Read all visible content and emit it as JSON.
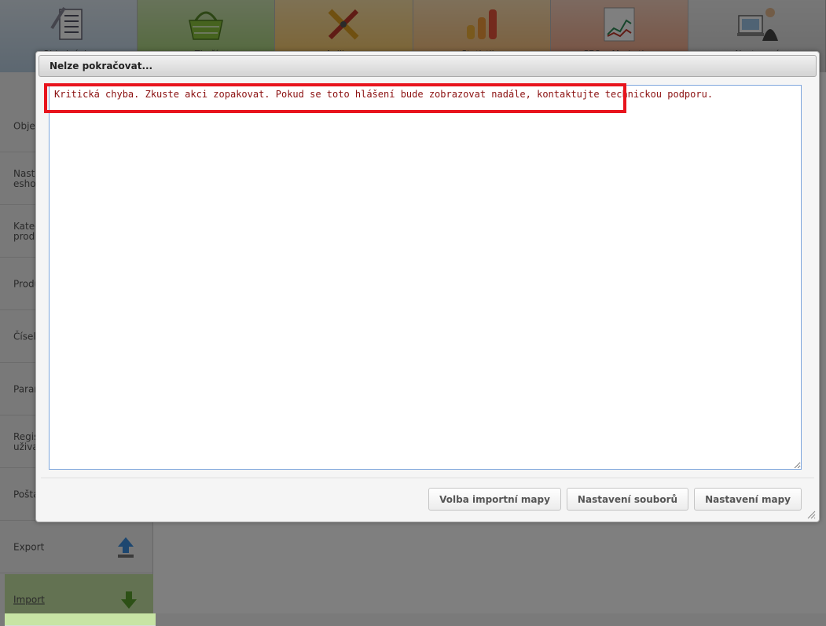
{
  "topnav": {
    "tiles": [
      {
        "label": "Objednávky",
        "icon": "checklist-icon"
      },
      {
        "label": "Zboží",
        "icon": "basket-icon"
      },
      {
        "label": "Aplikace",
        "icon": "tools-icon"
      },
      {
        "label": "Statistiky",
        "icon": "bar-chart-icon"
      },
      {
        "label": "SEO a Marketing",
        "icon": "line-chart-icon"
      },
      {
        "label": "Nastavení",
        "icon": "user-computer-icon"
      }
    ]
  },
  "sidebar": {
    "items": [
      {
        "label": "Objednávky"
      },
      {
        "label": "Nastavení\neshopu"
      },
      {
        "label": "Kategorie\nproduktů"
      },
      {
        "label": "Produkty"
      },
      {
        "label": "Číselníky"
      },
      {
        "label": "Parametry"
      },
      {
        "label": "Registrace\nuživatelů"
      },
      {
        "label": "Pošta"
      },
      {
        "label": "Export",
        "icon": "upload-arrow-icon"
      },
      {
        "label": "Import",
        "icon": "download-arrow-icon",
        "active": true
      }
    ]
  },
  "dialog": {
    "title": "Nelze pokračovat...",
    "message": "Kritická chyba. Zkuste akci zopakovat. Pokud se toto hlášení bude zobrazovat nadále, kontaktujte technickou podporu.",
    "buttons": {
      "import_map": "Volba importní mapy",
      "file_settings": "Nastavení souborů",
      "map_settings": "Nastavení mapy"
    }
  },
  "colors": {
    "error_text": "#8b1010",
    "highlight": "#e8141d",
    "textarea_border": "#7ea6dd",
    "active_sidebar": "#c7e4a4"
  }
}
